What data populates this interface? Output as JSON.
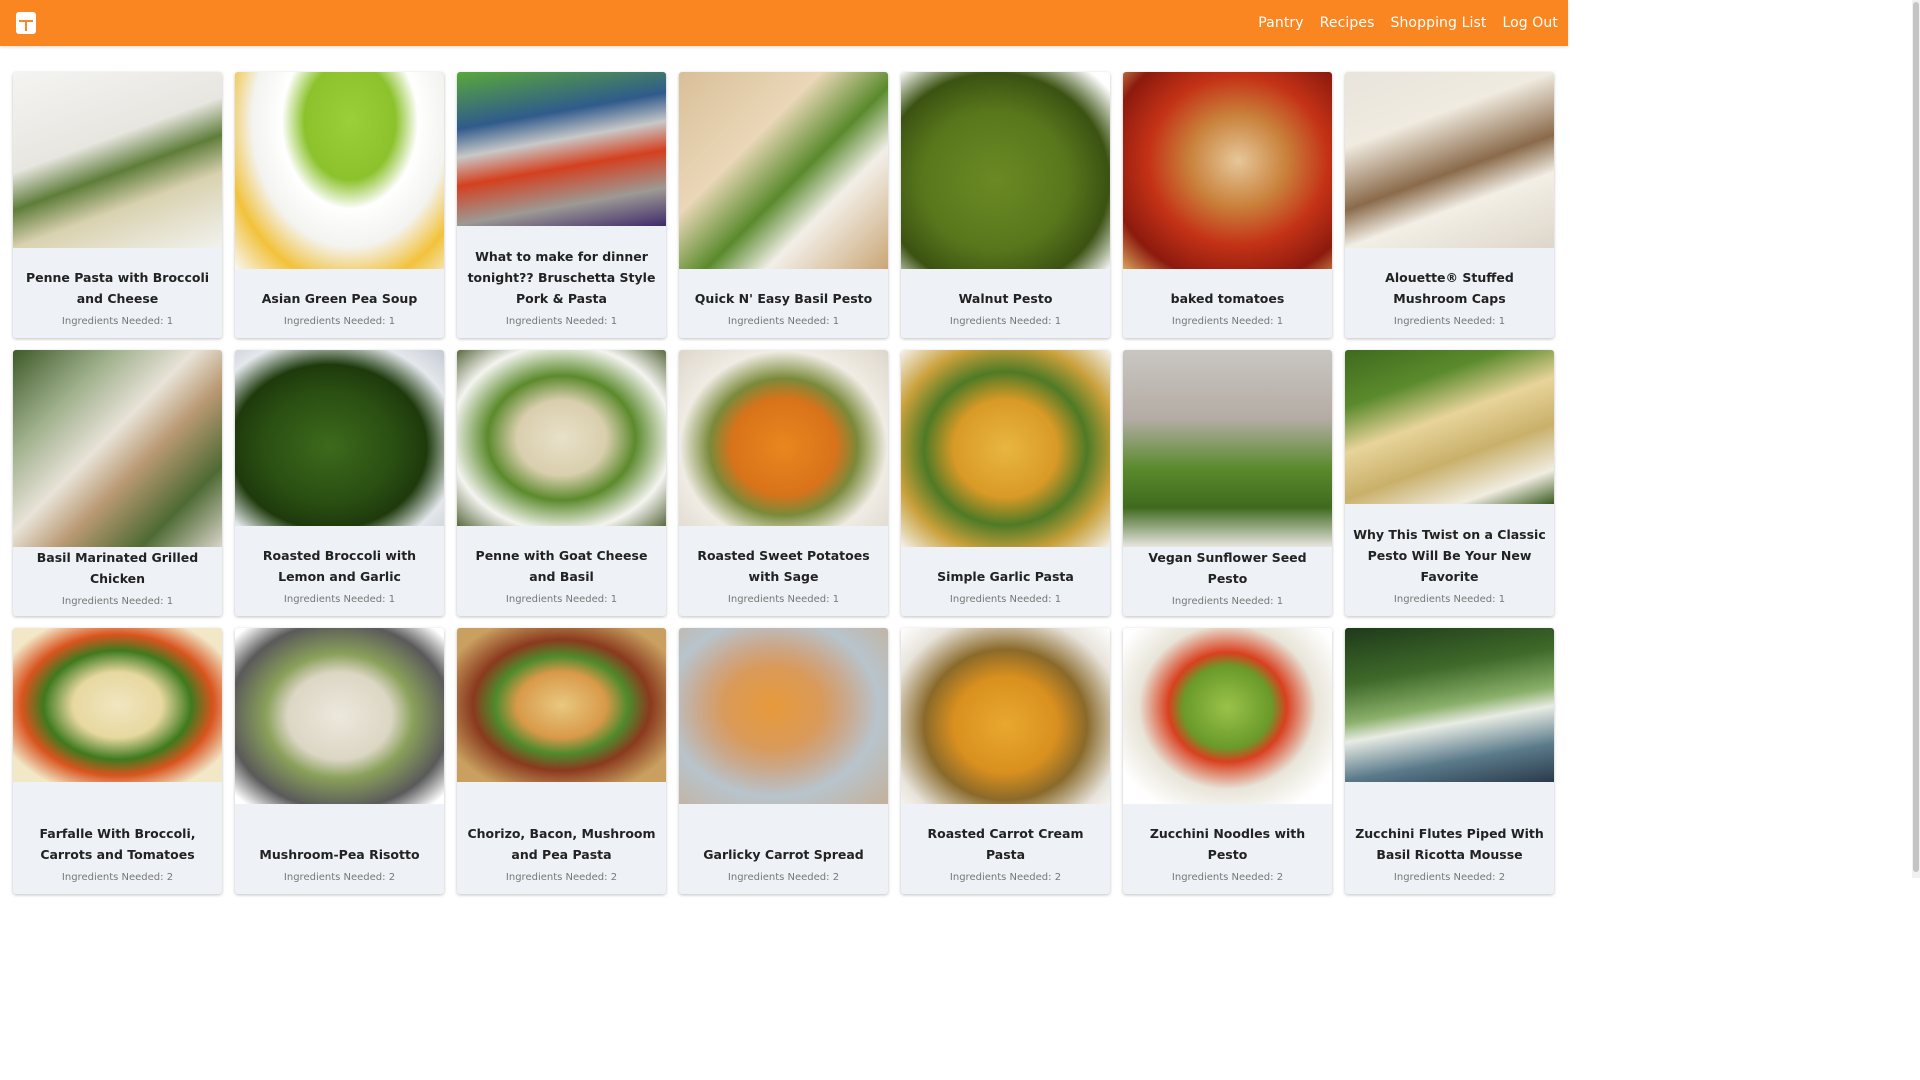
{
  "nav": {
    "logo_icon": "pantry-grid-icon",
    "links": [
      "Pantry",
      "Recipes",
      "Shopping List",
      "Log Out"
    ],
    "accent": "#f98620"
  },
  "recipes": [
    {
      "title": "Penne Pasta with Broccoli and Cheese",
      "meta": "Ingredients Needed: 1",
      "img_h": 176,
      "bg": "linear-gradient(160deg,#f4f4f2 0%,#e8e6e0 40%,#5f7d3a 55%,#d9d2b0 70%,#f2f2ee 100%)"
    },
    {
      "title": "Asian Green Pea Soup",
      "meta": "Ingredients Needed: 1",
      "img_h": 197,
      "bg": "radial-gradient(ellipse at 55% 25%,#9ccf3a 0%,#8cc22c 28%,#ffffff 42%,#f3f3f0 60%,#f2c23a 78%,#f7f7f4 100%)"
    },
    {
      "title": "What to make for dinner tonight?? Bruschetta Style Pork & Pasta",
      "meta": "Ingredients Needed: 1",
      "img_h": 154,
      "bg": "linear-gradient(170deg,#5aa83a 0%,#2f5b8c 30%,#c8c8c8 45%,#d4401f 60%,#9d9a94 80%,#3f2a6a 100%)"
    },
    {
      "title": "Quick N' Easy Basil Pesto",
      "meta": "Ingredients Needed: 1",
      "img_h": 197,
      "bg": "linear-gradient(135deg,#d9bf98 0%,#ead7b8 35%,#5a8a2c 55%,#f2efe8 70%,#caa676 100%)"
    },
    {
      "title": "Walnut Pesto",
      "meta": "Ingredients Needed: 1",
      "img_h": 197,
      "bg": "radial-gradient(ellipse at 45% 55%,#6b8a24 0%,#58771c 45%,#3b5212 70%,#ffffff 92%)"
    },
    {
      "title": "baked tomatoes",
      "meta": "Ingredients Needed: 1",
      "img_h": 197,
      "bg": "radial-gradient(ellipse at 55% 45%,#e6c79a 0%,#c9813b 30%,#c43216 55%,#8c1a0e 80%,#d9a35a 100%)"
    },
    {
      "title": "Alouette® Stuffed Mushroom Caps",
      "meta": "Ingredients Needed: 1",
      "img_h": 176,
      "bg": "linear-gradient(160deg,#e9e4dc 0%,#f0ebe0 30%,#8a6a4a 55%,#f3efe6 70%,#ddd6ca 100%)"
    },
    {
      "title": "Basil Marinated Grilled Chicken",
      "meta": "Ingredients Needed: 1",
      "img_h": 197,
      "bg": "linear-gradient(135deg,#3f5a2a 0%,#9fb08c 25%,#e8e3d8 45%,#b89872 60%,#4f6a34 80%,#d9d4c8 100%)"
    },
    {
      "title": "Roasted Broccoli with Lemon and Garlic",
      "meta": "Ingredients Needed: 1",
      "img_h": 176,
      "bg": "radial-gradient(ellipse at 45% 55%,#3d6a1c 0%,#2a4f12 40%,#1e3a0c 60%,#e4e8ec 80%,#c5c9d4 100%)"
    },
    {
      "title": "Penne with Goat Cheese and Basil",
      "meta": "Ingredients Needed: 1",
      "img_h": 176,
      "bg": "radial-gradient(ellipse at 50% 50%,#e8e0c8 0%,#d9cfae 30%,#5c8a2c 50%,#f4f4f0 75%,#5a6a40 100%)"
    },
    {
      "title": "Roasted Sweet Potatoes with Sage",
      "meta": "Ingredients Needed: 1",
      "img_h": 176,
      "bg": "radial-gradient(ellipse at 50% 55%,#e8871e 0%,#d9731a 35%,#7a8a3a 50%,#f0ece4 70%,#ddd6ca 100%)"
    },
    {
      "title": "Simple Garlic Pasta",
      "meta": "Ingredients Needed: 1",
      "img_h": 197,
      "bg": "radial-gradient(ellipse at 50% 50%,#e8b640 0%,#d99a26 35%,#4f7a26 55%,#c9a03a 75%,#f4f2ec 100%)"
    },
    {
      "title": "Vegan Sunflower Seed Pesto",
      "meta": "Ingredients Needed: 1",
      "img_h": 197,
      "bg": "linear-gradient(180deg,#c9c6c2 0%,#b4aca4 35%,#5a8a2c 60%,#3f6a1e 80%,#e8e6e0 100%)"
    },
    {
      "title": "Why This Twist on a Classic Pesto Will Be Your New Favorite",
      "meta": "Ingredients Needed: 1",
      "img_h": 154,
      "bg": "linear-gradient(160deg,#3f6a1e 0%,#5a8a2c 25%,#e8d49a 45%,#c9b06a 65%,#f0ece0 85%,#3a5a22 100%)"
    },
    {
      "title": "Farfalle With Broccoli, Carrots and Tomatoes",
      "meta": "Ingredients Needed: 2",
      "img_h": 154,
      "bg": "radial-gradient(ellipse at 50% 50%,#f0e6c0 0%,#e8d8a0 30%,#3f7a1e 50%,#d9541e 65%,#f2e8c8 85%)"
    },
    {
      "title": "Mushroom-Pea Risotto",
      "meta": "Ingredients Needed: 2",
      "img_h": 176,
      "bg": "radial-gradient(ellipse at 50% 50%,#ece8dc 0%,#dcd6c4 35%,#8aa05a 50%,#5a5a5a 75%,#ffffff 95%)"
    },
    {
      "title": "Chorizo, Bacon, Mushroom and Pea Pasta",
      "meta": "Ingredients Needed: 2",
      "img_h": 154,
      "bg": "radial-gradient(ellipse at 50% 50%,#e8c880 0%,#d99a4a 30%,#4f8a2c 45%,#8a3a1e 60%,#c9a060 85%)"
    },
    {
      "title": "Garlicky Carrot Spread",
      "meta": "Ingredients Needed: 2",
      "img_h": 176,
      "bg": "radial-gradient(ellipse at 45% 45%,#e89a3a 0%,#d99a5a 30%,#caa88a 45%,#b8c4cc 65%,#c4b09a 100%)"
    },
    {
      "title": "Roasted Carrot Cream Pasta",
      "meta": "Ingredients Needed: 2",
      "img_h": 176,
      "bg": "radial-gradient(ellipse at 50% 55%,#e8a830 0%,#d9901e 35%,#8a6a2a 55%,#e8e4dc 80%,#ffffff 100%)"
    },
    {
      "title": "Zucchini Noodles with Pesto",
      "meta": "Ingredients Needed: 2",
      "img_h": 176,
      "bg": "radial-gradient(ellipse at 50% 45%,#9ac24a 0%,#6a9a2a 30%,#d9401e 40%,#e8e4d8 60%,#ffffff 85%)"
    },
    {
      "title": "Zucchini Flutes Piped With Basil Ricotta Mousse",
      "meta": "Ingredients Needed: 2",
      "img_h": 154,
      "bg": "linear-gradient(170deg,#1e3a1a 0%,#3f6a2a 30%,#8ab06a 50%,#e8ece4 60%,#5a7a8a 80%,#2a3a4a 100%)"
    }
  ]
}
